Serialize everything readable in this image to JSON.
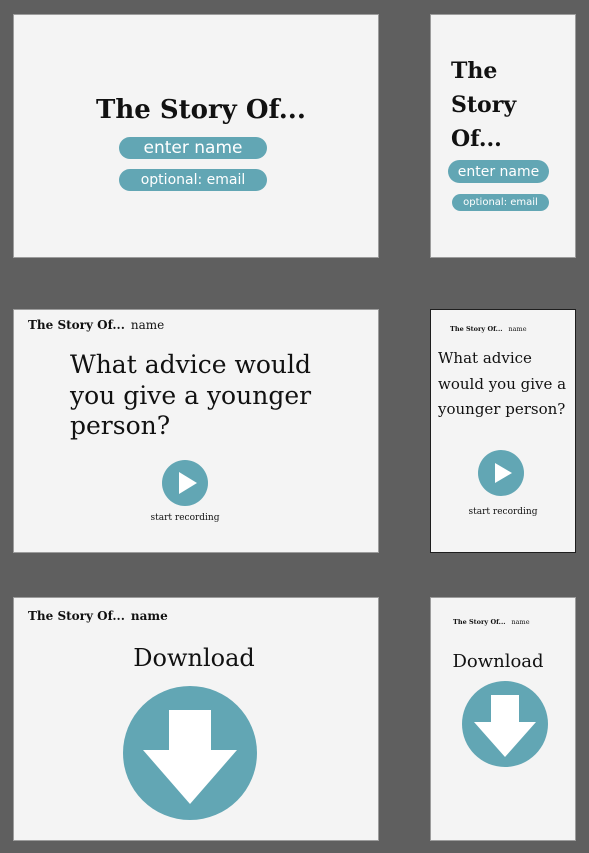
{
  "landing": {
    "title": "The Story Of...",
    "title_line1": "The",
    "title_line2": "Story",
    "title_line3": "Of...",
    "name_placeholder": "enter name",
    "email_placeholder": "optional: email"
  },
  "question": {
    "header_title": "The Story Of...",
    "header_name": "name",
    "prompt": "What advice would you give a younger person?",
    "record_label": "start recording"
  },
  "download": {
    "header_title": "The Story Of...",
    "header_name": "name",
    "heading": "Download"
  },
  "colors": {
    "accent": "#62a6b4",
    "background": "#5f5f5f",
    "card": "#f4f4f4"
  },
  "icons": {
    "play": "play-icon",
    "download": "download-arrow-icon"
  }
}
